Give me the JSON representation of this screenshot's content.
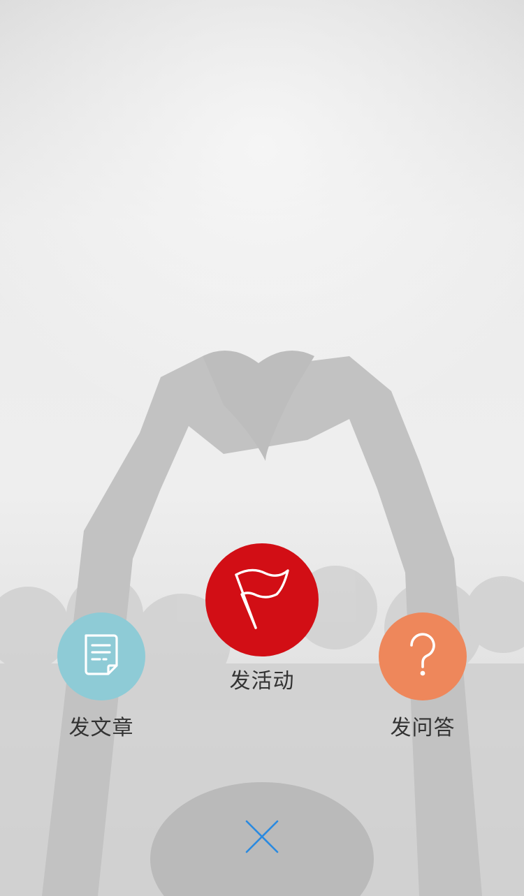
{
  "background": {
    "description_icon": "concert-heart-hands-photo"
  },
  "actions": {
    "article": {
      "label": "发文章",
      "icon": "document-icon",
      "color": "#8ecbd6"
    },
    "event": {
      "label": "发活动",
      "icon": "flag-icon",
      "color": "#d20e15"
    },
    "qa": {
      "label": "发问答",
      "icon": "question-icon",
      "color": "#ee875b"
    }
  },
  "close": {
    "icon": "close-icon",
    "color": "#2a8ae0"
  }
}
